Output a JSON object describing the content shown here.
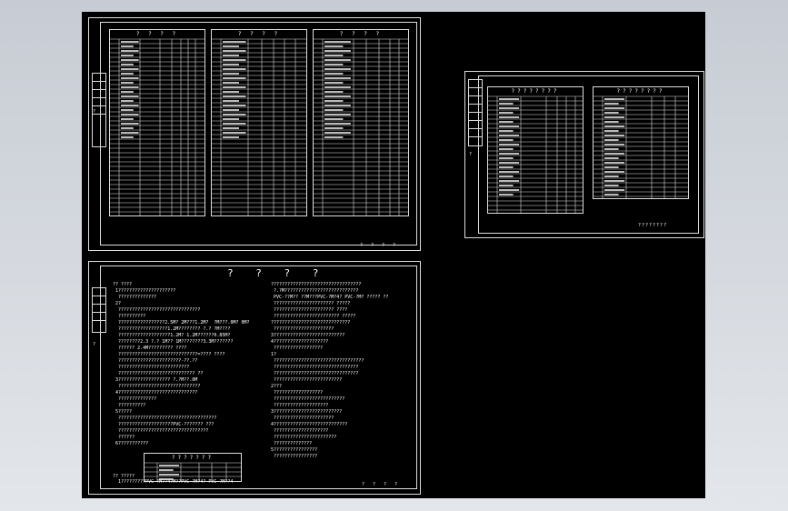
{
  "sheet1": {
    "tables": [
      {
        "title": "? ? ? ?",
        "header": [
          "?",
          "?",
          "?",
          "?"
        ],
        "rows": 38
      },
      {
        "title": "? ? ? ?",
        "header": [
          "?",
          "?",
          "?",
          "?"
        ],
        "rows": 38
      },
      {
        "title": "? ? ? ?",
        "header": [
          "?",
          "?",
          "?",
          "?"
        ],
        "rows": 38
      }
    ],
    "stamp": "? ? ? ?",
    "side_mark": "?"
  },
  "sheet2": {
    "tables": [
      {
        "title": "????????",
        "rows": 26
      },
      {
        "title": "????????",
        "rows": 26
      }
    ],
    "stamp": "????????",
    "side_mark": "?"
  },
  "sheet3": {
    "heading": "? ? ? ?",
    "stamp": "? ? ? ?",
    "side_mark": "?",
    "left_lines": [
      "?? ????",
      " 1?????????????????????",
      "  ??????????????",
      " 2?",
      "  ??????????????????????????????",
      "  ??????????",
      "  ?????????????????2.5M? 2M???1.2M?  ?M???.0M? 0M?",
      "  ??????????????????1.2M???????? ?.? ?M????",
      "  ???????????????????1.2M? 1.2M??????0.85M?",
      "  ????????2.3 ?.? 1M?? 1M????????3.3M???????",
      "  ?????? 2.4M????????? ????",
      "  ?????????????????????????????=???? ????",
      "  ???????????????????????-??.??",
      "  ??????????????????????????",
      "  ???????????????????????????? ??",
      " 3??????????????????? ?.?M??.0M",
      "  ??????????????????????????????",
      " 4?????????????????????????????",
      "  ??????????????",
      "  ??????????",
      " 5?????",
      "  ????????????????????????????????????",
      "  ????????????????????PVC-??????? ???",
      "  ?????????????????????????????????",
      "  ??????",
      " 6???????????"
    ],
    "right_lines": [
      "?????????????????????????????????",
      " ?.?M???????????????????????????",
      " PVC-??M?? ??M???PVC-?M?4? PVC-?M? ????? ??",
      " ?????????????????????? ?????",
      " ?????????????????????? ????",
      " ???????????????????????? ?????",
      "?????????????????????????????",
      " ??????????????????????",
      "3??????????????????????????",
      "4????????????????????",
      " ??????????????????",
      "1?",
      " ?????????????????????????????????",
      " ???????????????????????????????",
      " ???????????????????????????????",
      " ?????????????????????????",
      "2???",
      " ??????????????????",
      " ??????????????????????????",
      " ????????????????????",
      "3?????????????????????????",
      " ??????????????????????",
      "4???????????????????????????",
      " ????????????????????",
      " ???????????????????????",
      " ??????????????",
      "5????????????????",
      " ????????????????"
    ],
    "legend": {
      "title": "???????",
      "rows": [
        "?? ?? ??",
        "?? ?? ??",
        "?? ?? ??",
        "?? ?? ??",
        "?? ?? ??"
      ]
    },
    "footer_note": "?? ?????",
    "footer_line": "  1?????????PVC-?M??4?M??PVC-?M?4? PVC-?M??4"
  }
}
